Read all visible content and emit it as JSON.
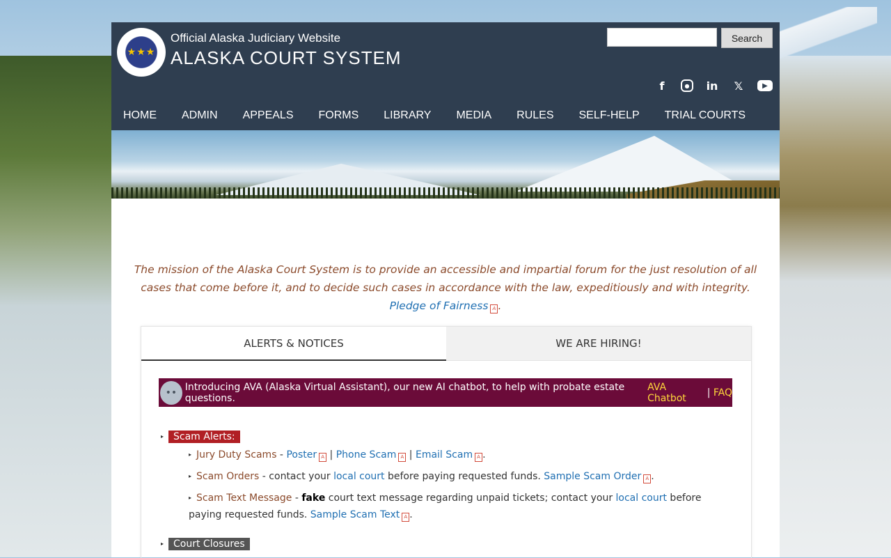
{
  "header": {
    "subtitle": "Official Alaska Judiciary Website",
    "title": "ALASKA COURT SYSTEM",
    "search_button": "Search",
    "search_placeholder": ""
  },
  "social": [
    "facebook-icon",
    "instagram-icon",
    "linkedin-icon",
    "x-icon",
    "youtube-icon"
  ],
  "nav": [
    "HOME",
    "ADMIN",
    "APPEALS",
    "FORMS",
    "LIBRARY",
    "MEDIA",
    "RULES",
    "SELF-HELP",
    "TRIAL COURTS"
  ],
  "mission": {
    "text": "The mission of the Alaska Court System is to provide an accessible and impartial forum for the just resolution of all cases that come before it, and to decide such cases in accordance with the law, expeditiously and with integrity.",
    "link": "Pledge of Fairness"
  },
  "tabs": [
    "ALERTS & NOTICES",
    "WE ARE HIRING!"
  ],
  "ava": {
    "text": "Introducing AVA (Alaska Virtual Assistant), our new AI chatbot, to help with probate estate questions.",
    "link1": "AVA Chatbot",
    "sep": "|",
    "link2": "FAQ"
  },
  "alerts": {
    "scam_title": "Scam Alerts:",
    "jury": {
      "label": "Jury Duty Scams",
      "dash": " - ",
      "l1": "Poster",
      "l2": "Phone Scam",
      "l3": "Email Scam"
    },
    "orders": {
      "label": "Scam Orders",
      "text1": " - contact your ",
      "link1": "local court",
      "text2": " before paying requested funds. ",
      "link2": "Sample Scam Order"
    },
    "textmsg": {
      "label": "Scam Text Message",
      "text1": " - ",
      "bold": "fake",
      "text2": " court text message regarding unpaid tickets; contact your ",
      "link1": "local court",
      "text3": " before paying requested funds. ",
      "link2": "Sample Scam Text"
    },
    "closures_title": "Court Closures"
  }
}
